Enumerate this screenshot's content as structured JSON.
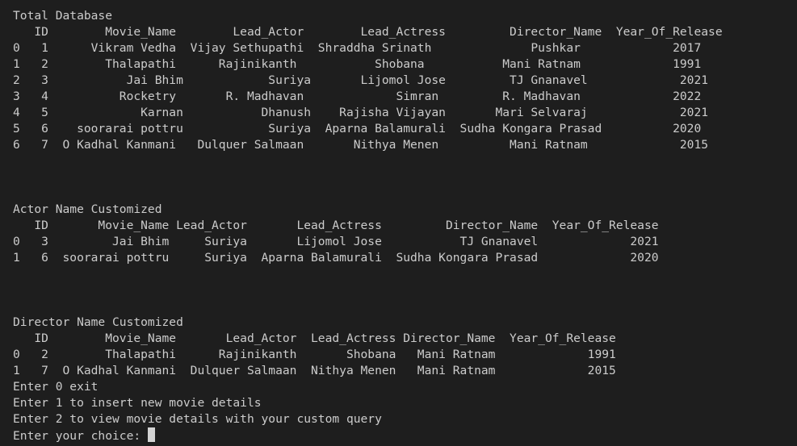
{
  "terminal": {
    "lines": [
      "Total Database",
      "   ID        Movie_Name        Lead_Actor        Lead_Actress         Director_Name  Year_Of_Release",
      "0   1      Vikram Vedha  Vijay Sethupathi  Shraddha Srinath              Pushkar             2017",
      "1   2        Thalapathi      Rajinikanth           Shobana           Mani Ratnam             1991",
      "2   3           Jai Bhim            Suriya       Lijomol Jose         TJ Gnanavel             2021",
      "3   4          Rocketry       R. Madhavan             Simran         R. Madhavan             2022",
      "4   5             Karnan           Dhanush    Rajisha Vijayan       Mari Selvaraj             2021",
      "5   6    soorarai pottru            Suriya  Aparna Balamurali  Sudha Kongara Prasad          2020",
      "6   7  O Kadhal Kanmani   Dulquer Salmaan       Nithya Menen          Mani Ratnam             2015",
      "",
      "",
      "",
      "Actor Name Customized",
      "   ID       Movie_Name Lead_Actor       Lead_Actress         Director_Name  Year_Of_Release",
      "0   3         Jai Bhim     Suriya       Lijomol Jose           TJ Gnanavel             2021",
      "1   6  soorarai pottru     Suriya  Aparna Balamurali  Sudha Kongara Prasad             2020",
      "",
      "",
      "",
      "Director Name Customized",
      "   ID        Movie_Name       Lead_Actor  Lead_Actress Director_Name  Year_Of_Release",
      "0   2        Thalapathi      Rajinikanth       Shobana   Mani Ratnam             1991",
      "1   7  O Kadhal Kanmani  Dulquer Salmaan  Nithya Menen   Mani Ratnam             2015",
      "Enter 0 exit",
      "Enter 1 to insert new movie details",
      "Enter 2 to view movie details with your custom query",
      "Enter your choice: "
    ]
  }
}
